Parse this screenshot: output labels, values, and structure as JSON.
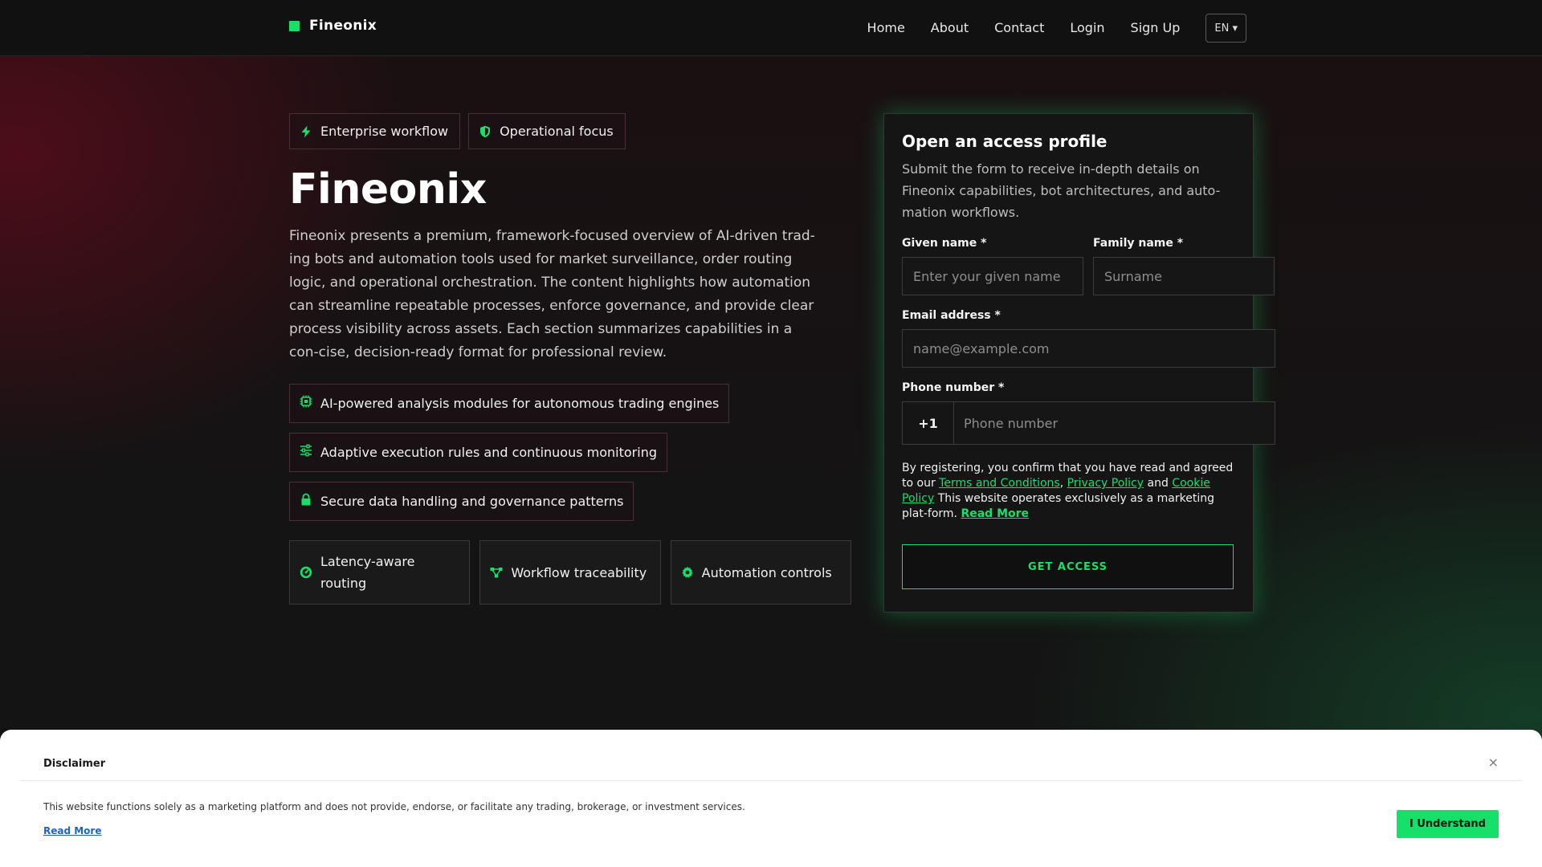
{
  "brand": {
    "name": "Fineonix",
    "accent": "#16e06a"
  },
  "nav": {
    "items": [
      "Home",
      "About",
      "Contact",
      "Login",
      "Sign Up"
    ],
    "language": "EN ▾"
  },
  "hero": {
    "pills": [
      {
        "label": "Enterprise workflow",
        "icon": "bolt-icon"
      },
      {
        "label": "Operational focus",
        "icon": "shield-icon"
      }
    ],
    "title": "Fineonix",
    "description": "Fineonix presents a premium, framework-focused overview of AI-driven trad-ing bots and automation tools used for market surveillance, order routing logic, and operational orchestration. The content highlights how automation can streamline repeatable processes, enforce governance, and provide clear process visibility across assets. Each section summarizes capabilities in a con-cise, decision-ready format for professional review.",
    "features": [
      {
        "label": "AI-powered analysis modules for autonomous trading engines",
        "icon": "chip-icon"
      },
      {
        "label": "Adaptive execution rules and continuous monitoring",
        "icon": "sliders-icon"
      },
      {
        "label": "Secure data handling and governance patterns",
        "icon": "lock-icon"
      }
    ],
    "cards": [
      {
        "label": "Latency-aware routing",
        "icon": "gauge-icon"
      },
      {
        "label": "Workflow traceability",
        "icon": "nodes-icon"
      },
      {
        "label": "Automation controls",
        "icon": "gear-icon"
      }
    ]
  },
  "form": {
    "title": "Open an access profile",
    "subtitle": "Submit the form to receive in-depth details on Fineonix capabilities, bot architectures, and auto-mation workflows.",
    "given_name": {
      "label": "Given name *",
      "placeholder": "Enter your given name",
      "value": ""
    },
    "family_name": {
      "label": "Family name *",
      "placeholder": "Surname",
      "value": ""
    },
    "email": {
      "label": "Email address *",
      "placeholder": "name@example.com",
      "value": ""
    },
    "phone": {
      "label": "Phone number *",
      "code": "+1",
      "placeholder": "Phone number",
      "value": ""
    },
    "legal": {
      "text1": "By registering, you confirm that you have read and agreed to our ",
      "terms": "Terms and Conditions",
      "sep": ", ",
      "privacy": "Privacy Policy",
      "and": " and ",
      "cookie": "Cookie Policy",
      "text2": " This website operates exclusively as a marketing plat-form. ",
      "read_more": "Read More"
    },
    "submit": "GET ACCESS"
  },
  "disclaimer": {
    "title": "Disclaimer",
    "close": "×",
    "text": "This website functions solely as a marketing platform and does not provide, endorse, or facilitate any trading, brokerage, or investment services.",
    "read_more": "Read More",
    "button": "I Understand"
  }
}
